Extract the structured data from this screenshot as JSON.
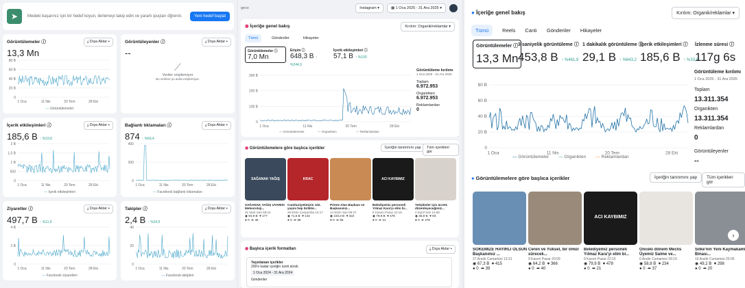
{
  "banner": {
    "text": "Medeki başarınız için bir hedef koyun, ilerlemeyi takip edin ve yararlı ipuçları öğrenin.",
    "button": "Yeni hedef başlat"
  },
  "export_label": "Dışa Aktar",
  "p1": {
    "cards": [
      {
        "title": "Görüntülemeler",
        "value": "13,3 Mn",
        "change": "",
        "legend": "Görüntülemeler",
        "yticks": [
          "80 B",
          "60 B",
          "40 B",
          "20 B",
          "0"
        ],
        "xticks": [
          "1 Oca",
          "11 Nis",
          "20 Tem",
          "28 Eki"
        ]
      },
      {
        "title": "Görüntüleyenler",
        "value": "--",
        "empty_title": "Veriler erişilemiyor",
        "empty_sub": "Bu verilere şu anda erişilemiyor."
      },
      {
        "title": "İçerik etkileşimleri",
        "value": "185,6 B",
        "change": "%33,8",
        "legend": "İçerik etkileşimleri",
        "yticks": [
          "2 B",
          "1,5 B",
          "1 B",
          "500",
          "0"
        ],
        "xticks": [
          "1 Oca",
          "11 Nis",
          "20 Tem",
          "28 Eki"
        ]
      },
      {
        "title": "Bağlantı tıklamaları",
        "value": "874",
        "change": "%69,4",
        "legend": "Facebook bağlantı tıklamaları",
        "yticks": [
          "400",
          "200",
          "0"
        ],
        "xticks": [
          "1 Oca",
          "11 Nis",
          "20 Tem",
          "28 Eki"
        ]
      },
      {
        "title": "Ziyaretler",
        "value": "497,7 B",
        "change": "%11,9",
        "legend": "Facebook ziyaretleri",
        "yticks": [
          "4 B",
          "2 B",
          "0"
        ],
        "xticks": [
          "1 Oca",
          "11 Nis",
          "20 Tem",
          "28 Eki"
        ]
      },
      {
        "title": "Takipler",
        "value": "2,4 B",
        "change": "%24,5",
        "legend": "Facebook takipleri",
        "yticks": [
          "40",
          "20",
          "0"
        ],
        "xticks": [
          "1 Oca",
          "11 Nis",
          "20 Tem",
          "28 Eki"
        ]
      }
    ]
  },
  "p2": {
    "topbar_left": "gece",
    "platform": "Instagram",
    "date_range": "1 Oca 2025 - 31 Ara 2025",
    "section_title": "İçeriğe genel bakış",
    "filter": "Kırılım: Organik/reklamlar",
    "tabs": [
      "Tümü",
      "Gönderiler",
      "Hikayeler"
    ],
    "metrics": [
      {
        "label": "Görüntülemeler",
        "value": "7,0 Mn",
        "change": ""
      },
      {
        "label": "Erişim",
        "value": "648,3 B",
        "change": "%244,9"
      },
      {
        "label": "İçerik etkileşimleri",
        "value": "57,1 B",
        "change": "%100"
      }
    ],
    "side": {
      "title": "Görüntüleme kırılımı",
      "range": "1 Oca 2025 - 31 Ara 2025",
      "total_label": "Toplam",
      "total": "6.972.953",
      "organic_label": "Organikten",
      "organic": "6.972.953",
      "ads_label": "Reklamlardan",
      "ads": "0"
    },
    "yticks": [
      "300 B",
      "200 B",
      "100 B",
      "0"
    ],
    "xticks": [
      "1 Oca",
      "11 Nis",
      "20 Tem",
      "28 Eki"
    ],
    "legend": [
      "Görüntülemeler",
      "Organikten",
      "Reklamlardan"
    ],
    "top_title": "Görüntülemelere göre başlıca içerikler",
    "btn_boost": "İçeriğin tanıtımını yap",
    "btn_all": "Tüm içerikleri gör",
    "posts": [
      {
        "caption": "SAĞANAK YAĞIŞ UYARISI Meteoroloji...",
        "date": "31 Mart Salı 08:24",
        "s1": "94,9 B",
        "s2": "177",
        "s3": "0",
        "s4": "49",
        "color": "#3a4a5c"
      },
      {
        "caption": "Cumhuriyetimizin 102. yaşını hep birlikte...",
        "date": "29 Ekim Çarşamba 10:17",
        "s1": "71,5 B",
        "s2": "142",
        "s3": "0",
        "s4": "99",
        "color": "#b5262b"
      },
      {
        "caption": "Priene Alan Başkanı ve Başkanımız...",
        "date": "14 Ekim Salı 09:27",
        "s1": "103,3 B",
        "s2": "422",
        "s3": "0",
        "s4": "66",
        "color": "#c98a54"
      },
      {
        "caption": "Belediyemiz personeli Yılmaz Kara'yı elim bi...",
        "date": "8 Kasım Pazar 22:15",
        "s1": "79,9 B",
        "s2": "478",
        "s3": "0",
        "s4": "21",
        "color": "#1a1a1a"
      },
      {
        "caption": "Yetişkinler için ücrets düzenleyeceğimiz...",
        "date": "2 Eylül Salı 14:58",
        "s1": "35,9 B",
        "s2": "93",
        "s3": "0",
        "s4": "275",
        "color": "#d8d2cc"
      }
    ],
    "formats_title": "Başlıca içerik formatları",
    "formats_card_title": "Yayınlanan içerikler",
    "formats_card_sub": "200'e kadar içeriğin özeti alındı",
    "formats_range": "1 Oca 2024 - 31 Ara 2024",
    "formats_row": "Gönderiler"
  },
  "p3": {
    "section_title": "İçeriğe genel bakış",
    "filter": "Kırılım: Organik/reklamlar",
    "tabs": [
      "Tümü",
      "Reels",
      "Canlı",
      "Gönderiler",
      "Hikayeler"
    ],
    "metrics": [
      {
        "label": "Görüntülemeler",
        "value": "13,3 Mn",
        "change": ""
      },
      {
        "label": "3 saniyelik görüntüleme",
        "value": "453,8 B",
        "change": "%461,9"
      },
      {
        "label": "1 dakikalık görüntüleme",
        "value": "29,1 B",
        "change": "%643,2"
      },
      {
        "label": "İçerik etkileşimleri",
        "value": "185,6 B",
        "change": "%33,8"
      },
      {
        "label": "İzlenme süresi",
        "value": "117g 6s",
        "change": ""
      }
    ],
    "side": {
      "title": "Görüntüleme kırılımı",
      "range": "1 Oca 2025 - 31 Ara 2025",
      "total_label": "Toplam",
      "total": "13.311.354",
      "organic_label": "Organikten",
      "organic": "13.311.354",
      "ads_label": "Reklamlardan",
      "ads": "0",
      "viewers_label": "Görüntüleyenler",
      "viewers": "--"
    },
    "yticks": [
      "80 B",
      "60 B",
      "40 B",
      "20 B",
      "0"
    ],
    "xticks": [
      "1 Oca",
      "11 Nis",
      "20 Tem",
      "28 Eki"
    ],
    "legend": [
      "Görüntülemeler",
      "Organikten",
      "Reklamlardan"
    ],
    "top_title": "Görüntülemelere göre başlıca içerikler",
    "btn_boost": "İçeriğin tanıtımını yap",
    "btn_all": "Tüm içerikleri gör",
    "posts": [
      {
        "caption": "SÖKEMİZE HAYIRLI OLSUN Başkanımız ...",
        "date": "27 Aralık Cumartesi 13:31",
        "s1": "67,3 B",
        "s2": "415",
        "s3": "0",
        "s4": "39",
        "color": "#6a8fb5"
      },
      {
        "caption": "Ceren ve Yüksel, bir ömür sürecek...",
        "date": "9 Kasım Pazar 20:09",
        "s1": "64,2 B",
        "s2": "366",
        "s3": "0",
        "s4": "40",
        "color": "#9a8a7a"
      },
      {
        "caption": "Belediyemiz personeli Yılmaz Kara'yı elim bi...",
        "date": "9 Kasım Pazar 22:15",
        "s1": "79,9 B",
        "s2": "478",
        "s3": "0",
        "s4": "21",
        "color": "#1a1a1a"
      },
      {
        "caption": "Önceki dönem Meclis Üyemiz Saime ve...",
        "date": "6 Aralık Cumartesi 18:19",
        "s1": "58,8 B",
        "s2": "234",
        "s3": "0",
        "s4": "37",
        "color": "#e8e4e0"
      },
      {
        "caption": "Söke'nin Yeni Kaymakamlık Binası...",
        "date": "15 Aralık Cumartesi 20:05",
        "s1": "49,2 B",
        "s2": "298",
        "s3": "0",
        "s4": "20",
        "color": "#8a8f96"
      }
    ]
  },
  "post_titles": [
    "SAĞANAK YAĞIŞ",
    "KRAC",
    "",
    "ACI KAYBIMIZ",
    ""
  ],
  "post3_titles": [
    "",
    "",
    "ACI KAYBIMIZ",
    "",
    ""
  ]
}
